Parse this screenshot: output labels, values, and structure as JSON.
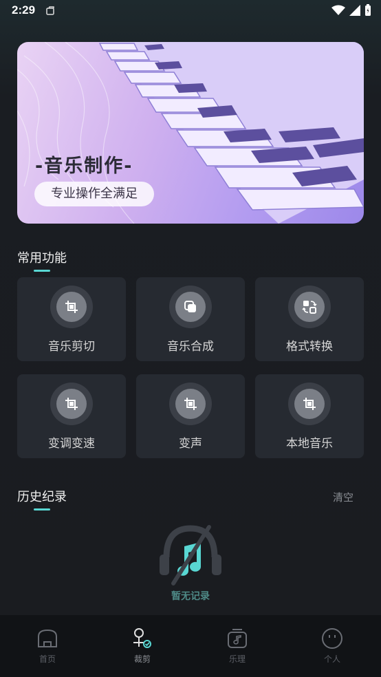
{
  "status_bar": {
    "time": "2:29"
  },
  "banner": {
    "title": "-音乐制作-",
    "subtitle": "专业操作全满足"
  },
  "common_functions": {
    "title": "常用功能",
    "items": [
      {
        "label": "音乐剪切",
        "icon": "crop-icon"
      },
      {
        "label": "音乐合成",
        "icon": "merge-icon"
      },
      {
        "label": "格式转换",
        "icon": "convert-icon"
      },
      {
        "label": "变调变速",
        "icon": "crop-icon"
      },
      {
        "label": "变声",
        "icon": "crop-icon"
      },
      {
        "label": "本地音乐",
        "icon": "crop-icon"
      }
    ]
  },
  "history": {
    "title": "历史纪录",
    "clear_label": "清空",
    "empty_text": "暂无记录"
  },
  "tabbar": {
    "items": [
      {
        "label": "首页",
        "icon": "home-icon"
      },
      {
        "label": "裁剪",
        "icon": "cut-icon",
        "active": true
      },
      {
        "label": "乐理",
        "icon": "music-theory-icon"
      },
      {
        "label": "个人",
        "icon": "smiley-icon"
      }
    ]
  },
  "colors": {
    "accent": "#59d7d3",
    "tile_bg": "#262a31",
    "tabbar_bg": "#111316"
  }
}
